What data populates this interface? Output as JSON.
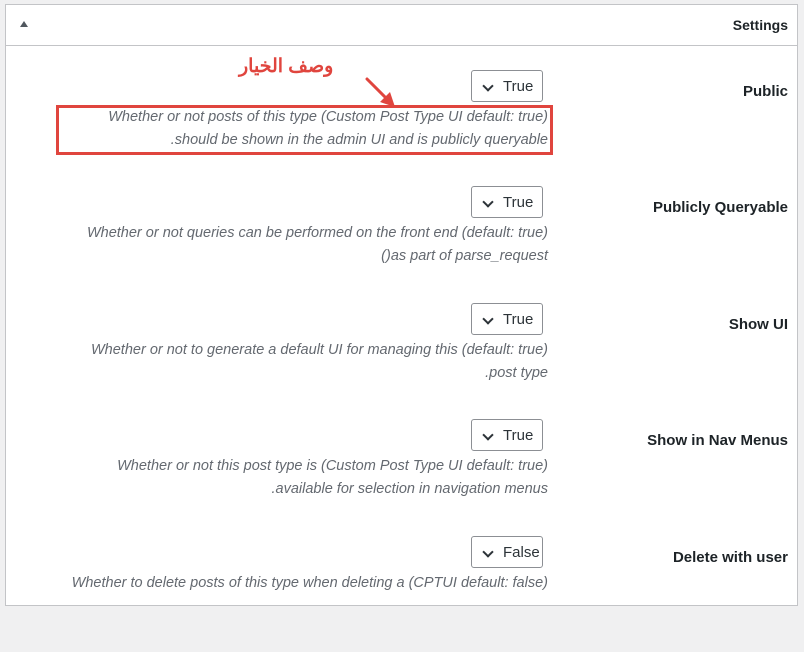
{
  "settings_panel": {
    "title": "Settings",
    "collapse_icon": "triangle-up-icon"
  },
  "annotation": {
    "label": "وصف الخيار",
    "color": "#e0453e"
  },
  "rows": [
    {
      "label": "Public",
      "value": "True",
      "description": [
        "Whether or not posts of this type (Custom Post Type UI default: true)",
        "should be shown in the admin UI and is publicly queryable."
      ]
    },
    {
      "label": "Publicly Queryable",
      "value": "True",
      "description": [
        "Whether or not queries can be performed on the front end (default: true)",
        "as part of parse_request()"
      ]
    },
    {
      "label": "Show UI",
      "value": "True",
      "description": [
        "Whether or not to generate a default UI for managing this (default: true)",
        "post type."
      ]
    },
    {
      "label": "Show in Nav Menus",
      "value": "True",
      "description": [
        "Whether or not this post type is (Custom Post Type UI default: true)",
        "available for selection in navigation menus."
      ]
    },
    {
      "label": "Delete with user",
      "value": "False",
      "description": [
        "Whether to delete posts of this type when deleting a (CPTUI default: false)"
      ]
    }
  ]
}
